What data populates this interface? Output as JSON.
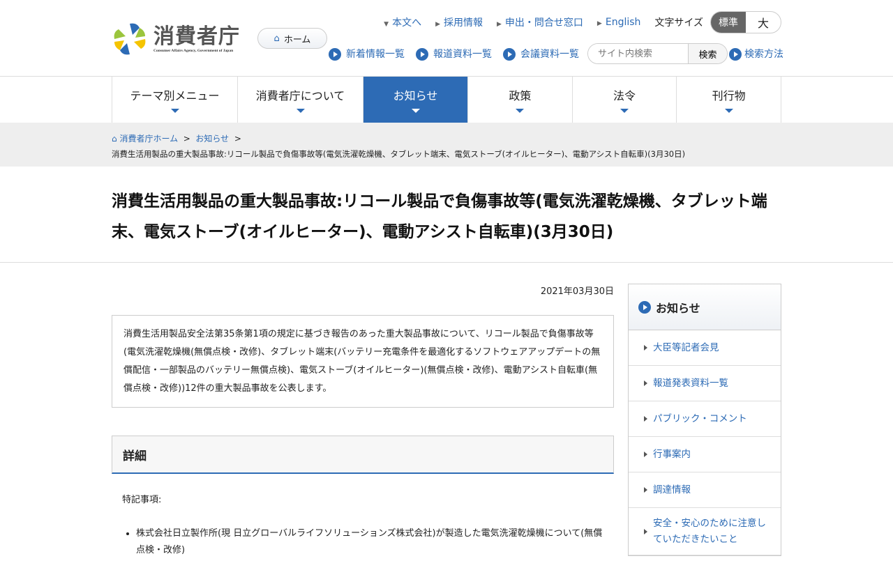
{
  "header": {
    "logo_text": "消費者庁",
    "logo_en": "Consumer Affairs Agency, Government of Japan",
    "home": "ホーム",
    "top_links": [
      "本文へ",
      "採用情報",
      "申出・問合せ窓口",
      "English"
    ],
    "font_size_label": "文字サイズ",
    "font_size_options": [
      "標準",
      "大"
    ],
    "sub_links": [
      "新着情報一覧",
      "報道資料一覧",
      "会議資料一覧"
    ],
    "search_placeholder": "サイト内検索",
    "search_button": "検索",
    "search_help": "検索方法"
  },
  "nav": [
    "テーマ別メニュー",
    "消費者庁について",
    "お知らせ",
    "政策",
    "法令",
    "刊行物"
  ],
  "breadcrumb": {
    "items": [
      "消費者庁ホーム",
      "お知らせ"
    ],
    "current": "消費生活用製品の重大製品事故:リコール製品で負傷事故等(電気洗濯乾燥機、タブレット端末、電気ストーブ(オイルヒーター)、電動アシスト自転車)(3月30日)"
  },
  "page_title": "消費生活用製品の重大製品事故:リコール製品で負傷事故等(電気洗濯乾燥機、タブレット端末、電気ストーブ(オイルヒーター)、電動アシスト自転車)(3月30日)",
  "date": "2021年03月30日",
  "lead": "消費生活用製品安全法第35条第1項の規定に基づき報告のあった重大製品事故について、リコール製品で負傷事故等(電気洗濯乾燥機(無償点検・改修)、タブレット端末(バッテリー充電条件を最適化するソフトウェアアップデートの無償配信・一部製品のバッテリー無償点検)、電気ストーブ(オイルヒーター)(無償点検・改修)、電動アシスト自転車(無償点検・改修))12件の重大製品事故を公表します。",
  "section": {
    "heading": "詳細",
    "note": "特記事項:",
    "items": [
      "株式会社日立製作所(現 日立グローバルライフソリューションズ株式会社)が製造した電気洗濯乾燥機について(無償点検・改修)"
    ]
  },
  "sidebar": {
    "title": "お知らせ",
    "items": [
      "大臣等記者会見",
      "報道発表資料一覧",
      "パブリック・コメント",
      "行事案内",
      "調達情報",
      "安全・安心のために注意していただきたいこと"
    ]
  }
}
